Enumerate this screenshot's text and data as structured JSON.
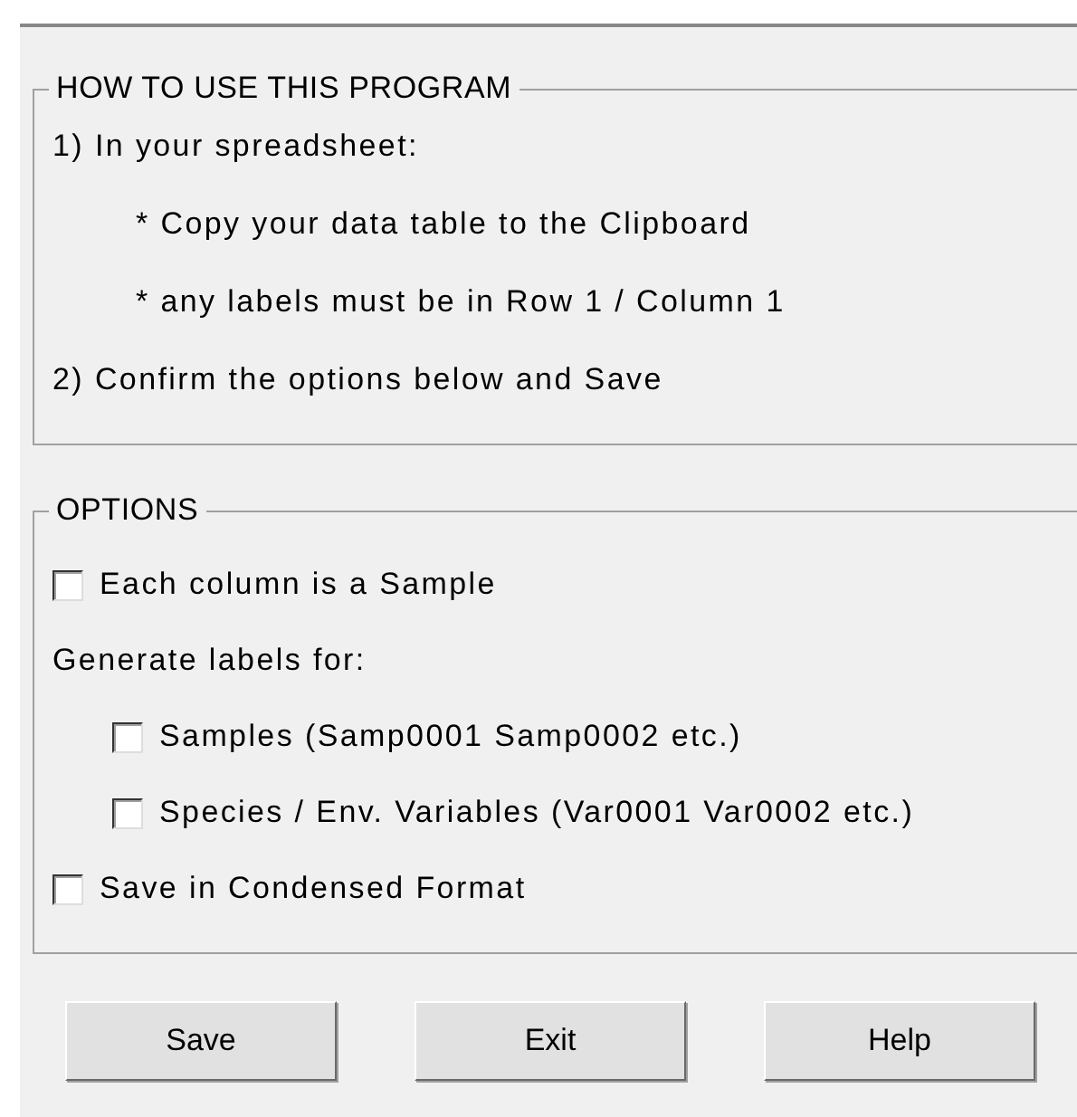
{
  "instructions": {
    "title": "HOW TO USE THIS PROGRAM",
    "lines": [
      {
        "kind": "step",
        "text": "1) In your spreadsheet:"
      },
      {
        "kind": "bullet",
        "text": "* Copy your data table to the Clipboard"
      },
      {
        "kind": "bullet",
        "text": "* any labels must be in Row 1  /  Column 1"
      },
      {
        "kind": "step",
        "text": "2) Confirm the options below and Save"
      }
    ]
  },
  "options": {
    "title": "OPTIONS",
    "items": [
      {
        "kind": "checkbox",
        "label": "Each column is a Sample",
        "checked": false,
        "indented": false
      },
      {
        "kind": "label",
        "label": "Generate labels for:"
      },
      {
        "kind": "checkbox",
        "label": "Samples (Samp0001 Samp0002 etc.)",
        "checked": false,
        "indented": true
      },
      {
        "kind": "checkbox",
        "label": "Species / Env. Variables (Var0001 Var0002 etc.)",
        "checked": false,
        "indented": true
      },
      {
        "kind": "checkbox",
        "label": "Save in Condensed Format",
        "checked": false,
        "indented": false
      }
    ]
  },
  "buttons": [
    "Save",
    "Exit",
    "Help"
  ]
}
